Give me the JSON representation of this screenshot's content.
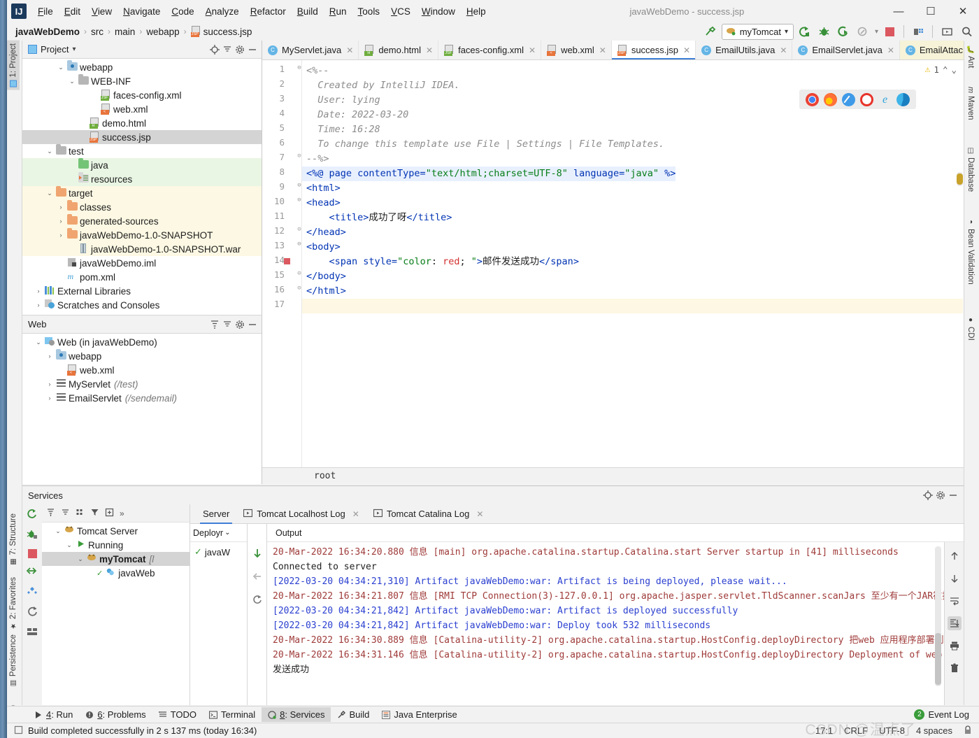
{
  "window": {
    "title": "javaWebDemo - success.jsp",
    "minimize": "—",
    "maximize": "☐",
    "close": "✕"
  },
  "menu": {
    "items": [
      "File",
      "Edit",
      "View",
      "Navigate",
      "Code",
      "Analyze",
      "Refactor",
      "Build",
      "Run",
      "Tools",
      "VCS",
      "Window",
      "Help"
    ]
  },
  "breadcrumb": {
    "project": "javaWebDemo",
    "items": [
      "src",
      "main",
      "webapp",
      "success.jsp"
    ],
    "separator": "›"
  },
  "toolbar": {
    "build_icon": "hammer-icon",
    "run_config": "myTomcat",
    "dropdown_caret": "▾",
    "run_icon": "run-icon",
    "debug_icon": "debug-icon",
    "run_coverage_icon": "run-with-coverage-icon",
    "profile_icon": "profile-icon",
    "stop_icon": "stop-icon",
    "project_structure_icon": "project-structure-icon",
    "select_target_icon": "select-target-icon",
    "search_icon": "search-everywhere-icon"
  },
  "left_strip": {
    "tabs": [
      {
        "label": "1: Project",
        "active": true,
        "icon": "project-icon"
      },
      {
        "label": "7: Structure",
        "active": false,
        "icon": "structure-icon"
      },
      {
        "label": "2: Favorites",
        "active": false,
        "icon": "star-icon"
      },
      {
        "label": "Persistence",
        "active": false,
        "icon": "persistence-icon"
      },
      {
        "label": "Web",
        "active": false,
        "icon": "web-icon"
      }
    ]
  },
  "right_strip": {
    "tabs": [
      {
        "label": "Ant",
        "icon": "ant-icon"
      },
      {
        "label": "Maven",
        "icon": "maven-icon"
      },
      {
        "label": "Database",
        "icon": "database-icon"
      },
      {
        "label": "Bean Validation",
        "icon": "bean-validation-icon"
      },
      {
        "label": "CDI",
        "icon": "cdi-icon"
      }
    ]
  },
  "project_panel": {
    "title": "Project",
    "title_caret": "▾",
    "actions": [
      "locate-icon",
      "collapse-all-icon",
      "settings-icon",
      "hide-icon"
    ],
    "tree": [
      {
        "label": "webapp",
        "indent": 3,
        "arrow": "⌄",
        "icon": "webapp-folder",
        "state": "none"
      },
      {
        "label": "WEB-INF",
        "indent": 4,
        "arrow": "⌄",
        "icon": "folder-grey",
        "state": "none"
      },
      {
        "label": "faces-config.xml",
        "indent": 6,
        "arrow": "",
        "icon": "jsf-file",
        "state": "none"
      },
      {
        "label": "web.xml",
        "indent": 6,
        "arrow": "",
        "icon": "xml-file",
        "state": "none"
      },
      {
        "label": "demo.html",
        "indent": 5,
        "arrow": "",
        "icon": "html-file",
        "state": "none"
      },
      {
        "label": "success.jsp",
        "indent": 5,
        "arrow": "",
        "icon": "jsp-file",
        "state": "sel"
      },
      {
        "label": "test",
        "indent": 2,
        "arrow": "⌄",
        "icon": "folder-grey",
        "state": "none"
      },
      {
        "label": "java",
        "indent": 4,
        "arrow": "",
        "icon": "folder-green",
        "state": "srcgreen"
      },
      {
        "label": "resources",
        "indent": 4,
        "arrow": "",
        "icon": "resources-folder",
        "state": "srcgreen"
      },
      {
        "label": "target",
        "indent": 2,
        "arrow": "⌄",
        "icon": "folder-orange",
        "state": "excl"
      },
      {
        "label": "classes",
        "indent": 3,
        "arrow": "›",
        "icon": "folder-orange",
        "state": "excl"
      },
      {
        "label": "generated-sources",
        "indent": 3,
        "arrow": "›",
        "icon": "folder-orange",
        "state": "excl"
      },
      {
        "label": "javaWebDemo-1.0-SNAPSHOT",
        "indent": 3,
        "arrow": "›",
        "icon": "folder-orange",
        "state": "excl"
      },
      {
        "label": "javaWebDemo-1.0-SNAPSHOT.war",
        "indent": 4,
        "arrow": "",
        "icon": "war-file",
        "state": "excl"
      },
      {
        "label": "javaWebDemo.iml",
        "indent": 3,
        "arrow": "",
        "icon": "iml-file",
        "state": "none"
      },
      {
        "label": "pom.xml",
        "indent": 3,
        "arrow": "",
        "icon": "maven-file",
        "state": "none"
      },
      {
        "label": "External Libraries",
        "indent": 1,
        "arrow": "›",
        "icon": "libraries-icon",
        "state": "none"
      },
      {
        "label": "Scratches and Consoles",
        "indent": 1,
        "arrow": "›",
        "icon": "scratches-icon",
        "state": "none"
      }
    ]
  },
  "web_panel": {
    "title": "Web",
    "actions": [
      "expand-all-icon",
      "collapse-all-icon",
      "settings-icon",
      "hide-icon"
    ],
    "tree": [
      {
        "label": "Web (in javaWebDemo)",
        "suffix": "",
        "indent": 1,
        "arrow": "⌄",
        "icon": "web-facet-icon"
      },
      {
        "label": "webapp",
        "suffix": "",
        "indent": 2,
        "arrow": "›",
        "icon": "webapp-folder"
      },
      {
        "label": "web.xml",
        "suffix": "",
        "indent": 3,
        "arrow": "",
        "icon": "xml-file"
      },
      {
        "label": "MyServlet",
        "suffix": "(/test)",
        "indent": 2,
        "arrow": "›",
        "icon": "servlet-icon"
      },
      {
        "label": "EmailServlet",
        "suffix": "(/sendemail)",
        "indent": 2,
        "arrow": "›",
        "icon": "servlet-icon"
      }
    ]
  },
  "editor": {
    "tabs": [
      {
        "label": "MyServlet.java",
        "icon": "java-class-file",
        "active": false,
        "pinned": false,
        "close": "✕"
      },
      {
        "label": "demo.html",
        "icon": "html-file",
        "active": false,
        "pinned": false,
        "close": "✕"
      },
      {
        "label": "faces-config.xml",
        "icon": "jsf-file",
        "active": false,
        "pinned": false,
        "close": "✕"
      },
      {
        "label": "web.xml",
        "icon": "xml-file",
        "active": false,
        "pinned": false,
        "close": "✕"
      },
      {
        "label": "success.jsp",
        "icon": "jsp-file",
        "active": true,
        "pinned": false,
        "close": "✕"
      },
      {
        "label": "EmailUtils.java",
        "icon": "java-class-file",
        "active": false,
        "pinned": false,
        "close": "✕"
      },
      {
        "label": "EmailServlet.java",
        "icon": "java-class-file",
        "active": false,
        "pinned": false,
        "close": "✕"
      },
      {
        "label": "EmailAttac",
        "icon": "java-class-file",
        "active": false,
        "pinned": true,
        "close": "⌄"
      }
    ],
    "warning_count": "1",
    "warning_up": "⌃",
    "warning_down": "⌄",
    "browsers": [
      "chrome-icon",
      "firefox-icon",
      "safari-icon",
      "opera-icon",
      "ie-icon",
      "edge-icon"
    ],
    "breadcrumb_bottom": "root",
    "gutter_lines": [
      "1",
      "2",
      "3",
      "4",
      "5",
      "6",
      "7",
      "8",
      "9",
      "10",
      "11",
      "12",
      "13",
      "14",
      "15",
      "16",
      "17"
    ],
    "breakpoint_line": 14,
    "code": [
      {
        "n": 1,
        "fold": "⊖",
        "hl": "",
        "parts": [
          {
            "t": "<%--",
            "c": "cmt"
          }
        ]
      },
      {
        "n": 2,
        "fold": "",
        "hl": "",
        "parts": [
          {
            "t": "  Created by IntelliJ IDEA.",
            "c": "cmt"
          }
        ]
      },
      {
        "n": 3,
        "fold": "",
        "hl": "",
        "parts": [
          {
            "t": "  User: lying",
            "c": "cmt"
          }
        ]
      },
      {
        "n": 4,
        "fold": "",
        "hl": "",
        "parts": [
          {
            "t": "  Date: 2022-03-20",
            "c": "cmt"
          }
        ]
      },
      {
        "n": 5,
        "fold": "",
        "hl": "",
        "parts": [
          {
            "t": "  Time: 16:28",
            "c": "cmt"
          }
        ]
      },
      {
        "n": 6,
        "fold": "",
        "hl": "",
        "parts": [
          {
            "t": "  To change this template use File | Settings | File Templates.",
            "c": "cmt"
          }
        ]
      },
      {
        "n": 7,
        "fold": "⊝",
        "hl": "",
        "parts": [
          {
            "t": "--%>",
            "c": "cmt"
          }
        ]
      },
      {
        "n": 8,
        "fold": "",
        "hl": "hl",
        "parts": [
          {
            "t": "<%@ ",
            "c": "kw"
          },
          {
            "t": "page ",
            "c": "tag"
          },
          {
            "t": "contentType=",
            "c": "attr"
          },
          {
            "t": "\"text/html;charset=UTF-8\"",
            "c": "str"
          },
          {
            "t": " ",
            "c": "txt"
          },
          {
            "t": "language=",
            "c": "attr"
          },
          {
            "t": "\"java\"",
            "c": "str"
          },
          {
            "t": " %>",
            "c": "kw"
          }
        ]
      },
      {
        "n": 9,
        "fold": "⊖",
        "hl": "",
        "parts": [
          {
            "t": "<html>",
            "c": "tag"
          }
        ]
      },
      {
        "n": 10,
        "fold": "⊖",
        "hl": "",
        "parts": [
          {
            "t": "<head>",
            "c": "tag"
          }
        ]
      },
      {
        "n": 11,
        "fold": "",
        "hl": "",
        "parts": [
          {
            "t": "    <title>",
            "c": "tag"
          },
          {
            "t": "成功了呀",
            "c": "txt"
          },
          {
            "t": "</title>",
            "c": "tag"
          }
        ]
      },
      {
        "n": 12,
        "fold": "⊝",
        "hl": "",
        "parts": [
          {
            "t": "</head>",
            "c": "tag"
          }
        ]
      },
      {
        "n": 13,
        "fold": "⊖",
        "hl": "",
        "parts": [
          {
            "t": "<body>",
            "c": "tag"
          }
        ]
      },
      {
        "n": 14,
        "fold": "",
        "hl": "",
        "parts": [
          {
            "t": "    <span ",
            "c": "tag"
          },
          {
            "t": "style=",
            "c": "attr"
          },
          {
            "t": "\"color",
            "c": "str"
          },
          {
            "t": ": ",
            "c": "txt"
          },
          {
            "t": "red",
            "c": "red"
          },
          {
            "t": "; ",
            "c": "txt"
          },
          {
            "t": "\"",
            "c": "str"
          },
          {
            "t": ">",
            "c": "tag"
          },
          {
            "t": "邮件发送成功",
            "c": "txt"
          },
          {
            "t": "</span>",
            "c": "tag"
          }
        ]
      },
      {
        "n": 15,
        "fold": "⊝",
        "hl": "",
        "parts": [
          {
            "t": "</body>",
            "c": "tag"
          }
        ]
      },
      {
        "n": 16,
        "fold": "⊝",
        "hl": "",
        "parts": [
          {
            "t": "</html>",
            "c": "tag"
          }
        ]
      },
      {
        "n": 17,
        "fold": "",
        "hl": "cur",
        "parts": [
          {
            "t": "",
            "c": "txt"
          }
        ]
      }
    ]
  },
  "services": {
    "title": "Services",
    "head_actions": [
      "locate-icon",
      "settings-icon",
      "hide-icon"
    ],
    "strip_icons": [
      "rerun-icon",
      "debug-icon",
      "stop-icon",
      "deploy-icon",
      "edit-config-icon",
      "restart-icon",
      "layout-icon"
    ],
    "tree_toolbar": [
      "expand-all-icon",
      "collapse-all-icon",
      "group-icon",
      "filter-icon",
      "add-icon",
      "more-icon"
    ],
    "tree": [
      {
        "label": "Tomcat Server",
        "suffix": "",
        "indent": 1,
        "arrow": "⌄",
        "icon": "tomcat-icon",
        "bold": false,
        "sel": false,
        "check": ""
      },
      {
        "label": "Running",
        "suffix": "",
        "indent": 2,
        "arrow": "⌄",
        "icon": "running-icon",
        "bold": false,
        "sel": false,
        "check": ""
      },
      {
        "label": "myTomcat",
        "suffix": "[l",
        "indent": 3,
        "arrow": "⌄",
        "icon": "tomcat-icon",
        "bold": true,
        "sel": true,
        "check": ""
      },
      {
        "label": "javaWeb",
        "suffix": "",
        "indent": 4,
        "arrow": "",
        "icon": "artifact-icon",
        "bold": false,
        "sel": false,
        "check": "✓"
      }
    ],
    "tabs": [
      {
        "label": "Server",
        "icon": "",
        "active": true,
        "close": ""
      },
      {
        "label": "Tomcat Localhost Log",
        "icon": "log-icon",
        "active": false,
        "close": "✕"
      },
      {
        "label": "Tomcat Catalina Log",
        "icon": "log-icon",
        "active": false,
        "close": "✕"
      }
    ],
    "deploy_header": "Deployr",
    "deploy_caret": "⌄",
    "deploy_item": "javaW",
    "deploy_item_check": "✓",
    "output_header": "Output",
    "console_side_icons": [
      "scroll-up-icon",
      "scroll-down-icon",
      "soft-wrap-icon",
      "scroll-to-end-icon",
      "print-icon",
      "clear-all-icon"
    ],
    "console": [
      {
        "parts": [
          {
            "t": "20-Mar-2022 16:34:20.880 ",
            "c": "lg-date"
          },
          {
            "t": "信息 ",
            "c": "lg-date"
          },
          {
            "t": "[main] org.apache.catalina.startup.Catalina.start Server startup in [41] milliseconds",
            "c": "lg-date"
          }
        ]
      },
      {
        "parts": [
          {
            "t": "Connected to server",
            "c": "lg-dark"
          }
        ]
      },
      {
        "parts": [
          {
            "t": "[2022-03-20 04:34:21,310] Artifact javaWebDemo:war: Artifact is being deployed, please wait...",
            "c": "lg-blue"
          }
        ]
      },
      {
        "parts": [
          {
            "t": "20-Mar-2022 16:34:21.807 信息 [RMI TCP Connection(3)-127.0.0.1] org.apache.jasper.servlet.TldScanner.scanJars ",
            "c": "lg-date"
          },
          {
            "t": "至少有一个JAR被扫描用于",
            "c": "lg-date"
          }
        ]
      },
      {
        "parts": [
          {
            "t": "[2022-03-20 04:34:21,842] Artifact javaWebDemo:war: Artifact is deployed successfully",
            "c": "lg-blue"
          }
        ]
      },
      {
        "parts": [
          {
            "t": "[2022-03-20 04:34:21,842] Artifact javaWebDemo:war: Deploy took 532 milliseconds",
            "c": "lg-blue"
          }
        ]
      },
      {
        "parts": [
          {
            "t": "20-Mar-2022 16:34:30.889 信息 [Catalina-utility-2] org.apache.catalina.startup.HostConfig.deployDirectory ",
            "c": "lg-date"
          },
          {
            "t": "把web 应用程序部署到目录 [D",
            "c": "lg-date"
          }
        ]
      },
      {
        "parts": [
          {
            "t": "20-Mar-2022 16:34:31.146 信息 [Catalina-utility-2] org.apache.catalina.startup.HostConfig.deployDirectory Deployment of web appli",
            "c": "lg-date"
          }
        ]
      },
      {
        "parts": [
          {
            "t": "发送成功",
            "c": "lg-dark"
          }
        ]
      }
    ]
  },
  "tool_windows": {
    "items": [
      {
        "label": "4: Run",
        "icon": "run-icon",
        "active": false
      },
      {
        "label": "6: Problems",
        "icon": "problems-icon",
        "active": false
      },
      {
        "label": "TODO",
        "icon": "todo-icon",
        "active": false
      },
      {
        "label": "Terminal",
        "icon": "terminal-icon",
        "active": false
      },
      {
        "label": "8: Services",
        "icon": "services-icon",
        "active": true
      },
      {
        "label": "Build",
        "icon": "build-icon",
        "active": false
      },
      {
        "label": "Java Enterprise",
        "icon": "java-enterprise-icon",
        "active": false
      }
    ]
  },
  "status_bar": {
    "message": "Build completed successfully in 2 s 137 ms (today 16:34)",
    "caret_position": "17:1",
    "line_separator": "CRLF",
    "encoding": "UTF-8",
    "indent": "4 spaces",
    "lock_icon": "lock-icon",
    "event_log": "Event Log",
    "event_log_count": "2"
  },
  "watermark": "CSDN @温点了"
}
